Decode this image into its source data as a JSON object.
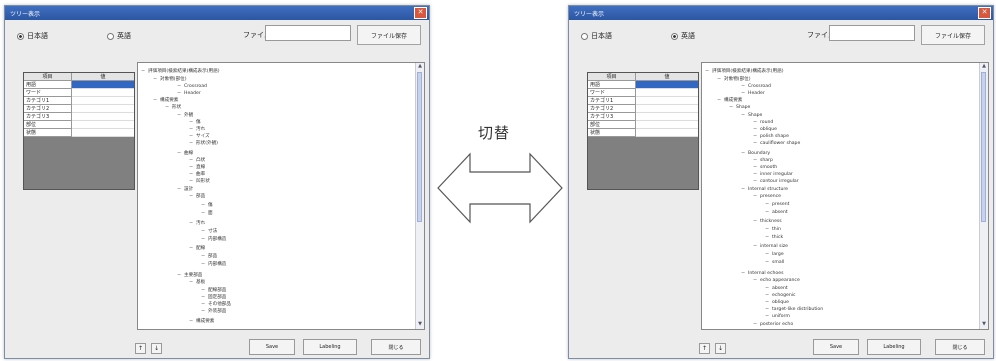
{
  "switch_label": "切替",
  "left": {
    "title": "ツリー表示",
    "radio_ja": "日本語",
    "radio_en": "英語",
    "selected": "ja",
    "file_name_label": "ファイル名",
    "file_name_value": "",
    "file_save_button": "ファイル保存",
    "table_headers": [
      "項目",
      "値"
    ],
    "table_rows": [
      [
        "用語",
        ""
      ],
      [
        "ワード",
        ""
      ],
      [
        "カテゴリ1",
        ""
      ],
      [
        "カテゴリ2",
        ""
      ],
      [
        "カテゴリ3",
        ""
      ],
      [
        "部位",
        ""
      ],
      [
        "状態",
        ""
      ]
    ],
    "tree_nodes": [
      "評価項目(検索結果)構成表示(用語)",
      "対象物(部位)",
      "Crossroad",
      "Header",
      "構成要素",
      "形状",
      "外観",
      "傷",
      "汚れ",
      "サイズ",
      "形状(外観)",
      "曲線",
      "凸状",
      "直線",
      "曲率",
      "凹形状",
      "設計",
      "部品",
      "傷",
      "面",
      "汚れ",
      "寸法",
      "内部構造",
      "配線",
      "部品",
      "内部構造",
      "主要部品",
      "基板",
      "配線部品",
      "固定部品",
      "その他部品",
      "外装部品",
      "構成要素"
    ],
    "btn_up": "↑",
    "btn_down": "↓",
    "btn_save": "Save",
    "btn_labeling": "Labeling",
    "btn_close": "閉じる"
  },
  "right": {
    "title": "ツリー表示",
    "radio_ja": "日本語",
    "radio_en": "英語",
    "selected": "en",
    "file_name_label": "ファイル名",
    "file_name_value": "",
    "file_save_button": "ファイル保存",
    "table_headers": [
      "項目",
      "値"
    ],
    "table_rows": [
      [
        "用語",
        ""
      ],
      [
        "ワード",
        ""
      ],
      [
        "カテゴリ1",
        ""
      ],
      [
        "カテゴリ2",
        ""
      ],
      [
        "カテゴリ3",
        ""
      ],
      [
        "部位",
        ""
      ],
      [
        "状態",
        ""
      ]
    ],
    "tree_nodes": [
      "評価項目(検索結果)構成表示(用語)",
      "対象物(部位)",
      "Crossroad",
      "Header",
      "構成要素",
      "Shape",
      "Shape",
      "round",
      "oblique",
      "polish shape",
      "cauliflower shape",
      "Boundary",
      "sharp",
      "smooth",
      "inner irregular",
      "contour irregular",
      "Internal structure",
      "presence",
      "present",
      "absent",
      "thickness",
      "thin",
      "thick",
      "internal size",
      "large",
      "small",
      "Internal echoes",
      "echo appearance",
      "absent",
      "echogenic",
      "oblique",
      "target-like distribution",
      "uniform",
      "posterior echo"
    ],
    "btn_up": "↑",
    "btn_down": "↓",
    "btn_save": "Save",
    "btn_labeling": "Labeling",
    "btn_close": "閉じる"
  },
  "colors": {
    "titlebar": "#2c56a3",
    "selection": "#3168c4",
    "close": "#d9573a"
  }
}
